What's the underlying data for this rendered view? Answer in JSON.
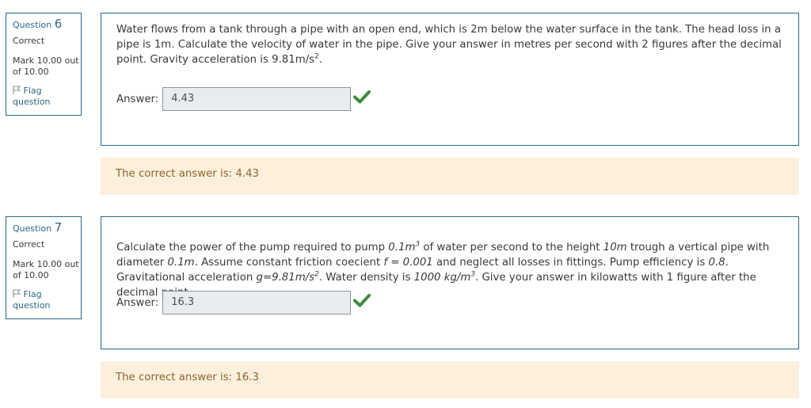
{
  "questions": [
    {
      "number_prefix": "Question",
      "number": "6",
      "state": "Correct",
      "grade": "Mark 10.00 out of 10.00",
      "flag_label": "Flag question",
      "text": [
        "Water flows from a tank through a pipe with an open end, which is 2m below the water surface in the tank. The head loss in a pipe is 1m. Calculate the velocity of water in the pipe. Give your answer in metres per second with 2 figures after the decimal point. Gravity acceleration is 9.81m/s",
        "2",
        "."
      ],
      "answer_label": "Answer:",
      "answer_value": "4.43",
      "feedback": "The correct answer is: 4.43"
    },
    {
      "number_prefix": "Question",
      "number": "7",
      "state": "Correct",
      "grade": "Mark 10.00 out of 10.00",
      "flag_label": "Flag question",
      "text": [
        "Calculate the power of the pump required to pump ",
        "0.1m",
        "3",
        " of water per second to the height ",
        "10m",
        " trough a vertical  pipe with diameter ",
        "0.1m",
        ". Assume constant friction coecient ",
        "f = 0.001",
        " and neglect all losses in fittings. Pump efficiency is ",
        "0.8",
        ". Gravitational acceleration ",
        "g=9.81m/s",
        "2",
        ". Water density is ",
        "1000 kg/m",
        "3",
        ".  Give your answer in kilowatts with 1 figure after the decimal point."
      ],
      "answer_label": "Answer:",
      "answer_value": "16.3",
      "feedback": "The correct answer is: 16.3"
    }
  ],
  "colors": {
    "accent": "#2a6987",
    "correct_check": "#3f8a3f",
    "feedback_bg": "#fcefdc",
    "feedback_text": "#8e662e",
    "input_bg": "#e9ecef"
  },
  "icons": {
    "flag": "flag-icon",
    "correct": "check-icon"
  }
}
